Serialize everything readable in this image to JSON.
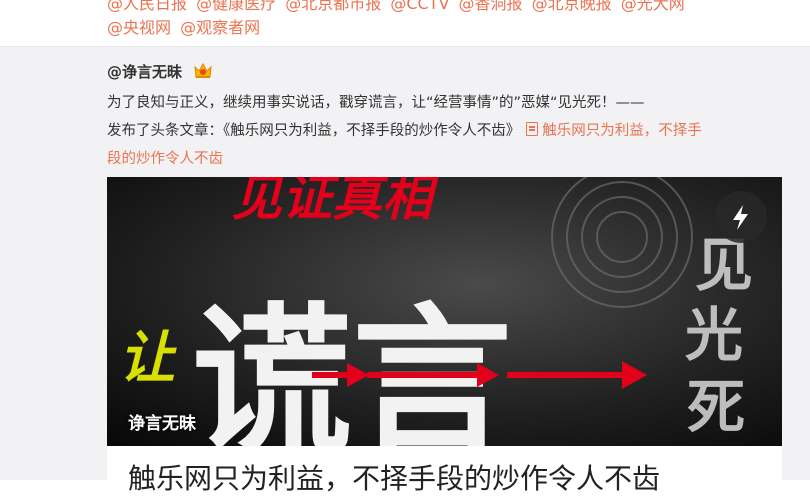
{
  "mentions_row1": [
    "@人民日报",
    "@健康医疗",
    "@北京都市报",
    "@CCTV",
    "@香洞报",
    "@北京晚报",
    "@光大网"
  ],
  "mentions_row2": [
    "@央视网",
    "@观察者网"
  ],
  "post": {
    "author": "@诤言无昧",
    "line1": "为了良知与正义，继续用事实说话，戳穿谎言，让“经营事情”的”恶媒“见光死！——",
    "line2_prefix": "发布了头条文章：《触乐网只为利益，不择手段的炒作令人不齿》",
    "link_part1": "触乐网只为利益，不择手",
    "link_part2": "段的炒作令人不齿"
  },
  "cover": {
    "headline": "见证真相",
    "side_text": "见光死",
    "big_text": "谎言",
    "prefix_text": "让",
    "caption": "诤言无昧",
    "flash_icon": "lightning-icon"
  },
  "article": {
    "title": "触乐网只为利益，不择手段的炒作令人不齿"
  },
  "colors": {
    "accent": "#eb7350",
    "background": "#f2f2f5",
    "text": "#333333"
  }
}
